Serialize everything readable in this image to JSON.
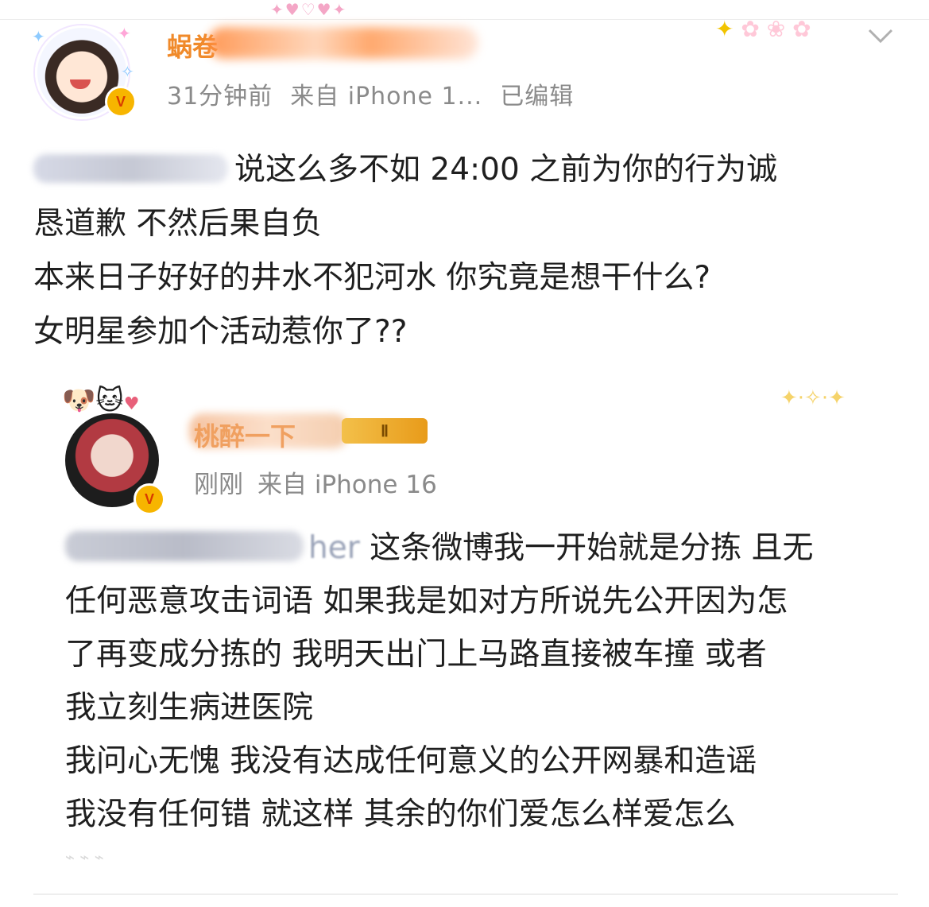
{
  "post": {
    "author_visible": "蜗卷",
    "time": "31分钟前",
    "source": "来自 iPhone 1...",
    "edited": "已编辑",
    "badge": "V",
    "text_line1": "说这么多不如 24:00 之前为你的行为诚",
    "text_line2": "恳道歉 不然后果自负",
    "text_line3": "本来日子好好的井水不犯河水 你究竟是想干什么?",
    "text_line4": "女明星参加个活动惹你了??"
  },
  "quoted": {
    "author_visible": "桃醉一下",
    "level_badge": "Ⅱ",
    "badge": "V",
    "time": "刚刚",
    "source": "来自 iPhone 16",
    "mention_tail": "her",
    "lines": [
      "这条微博我一开始就是分拣  且无",
      "任何恶意攻击词语  如果我是如对方所说先公开因为怎",
      "了再变成分拣的  我明天出门上马路直接被车撞  或者",
      "我立刻生病进医院",
      "我问心无愧  我没有达成任何意义的公开网暴和造谣",
      "我没有任何错  就这样  其余的你们爱怎么样爱怎么"
    ]
  },
  "icons": {
    "chevron": "chevron-down-icon",
    "verified": "verified-v-icon"
  },
  "colors": {
    "author": "#f08a2a",
    "meta": "#8a8a8a",
    "vbadge": "#f7b500"
  }
}
